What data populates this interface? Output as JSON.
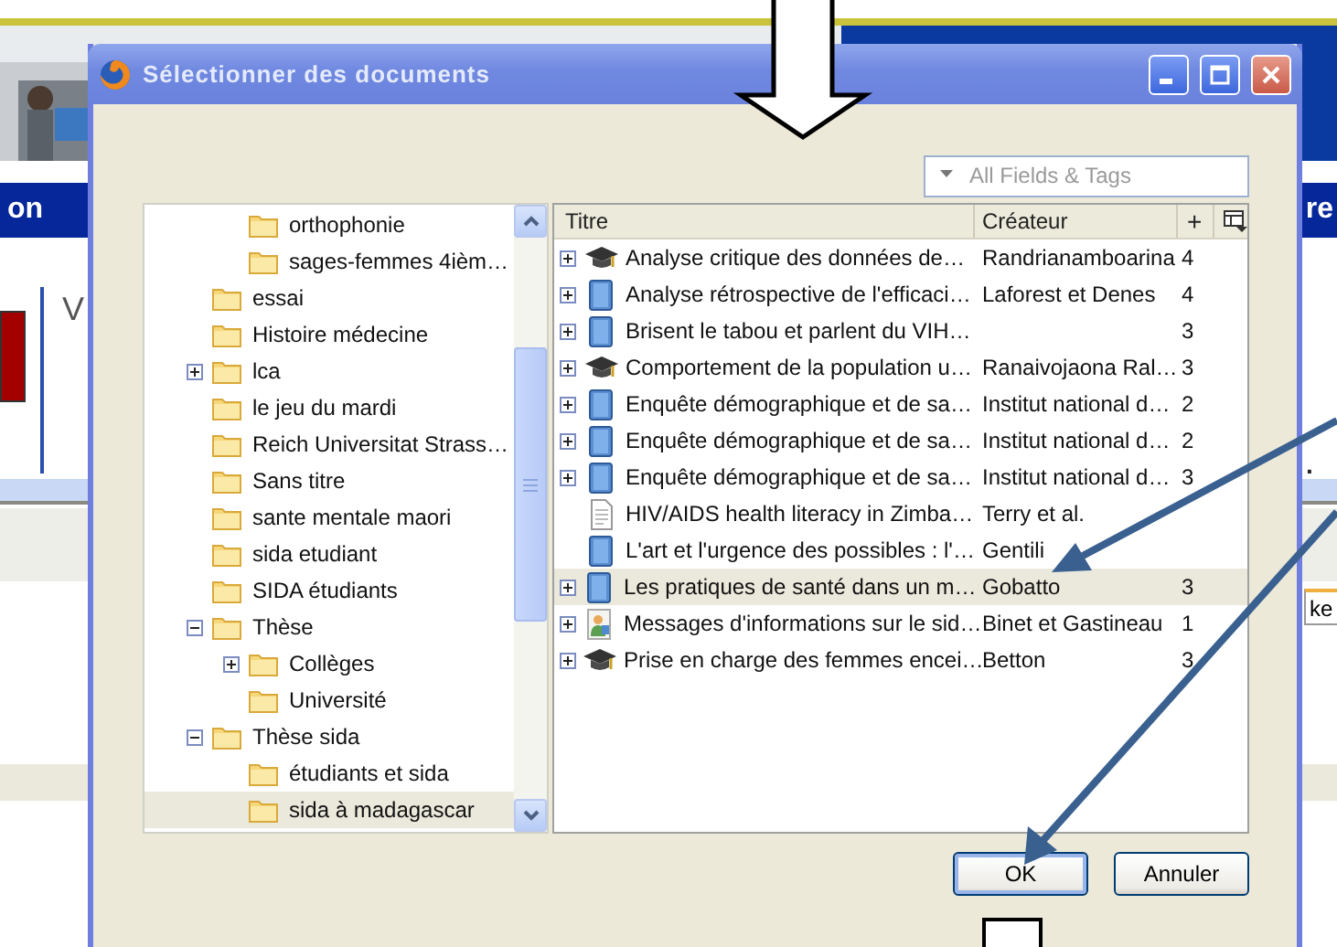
{
  "background_page": {
    "nav_left": "on",
    "nav_right": "re",
    "heading_letter": "V",
    "period": ".",
    "field_value": "ke"
  },
  "dialog": {
    "title": "Sélectionner des documents",
    "search": {
      "placeholder": "All Fields & Tags"
    },
    "tree": [
      {
        "children": [
          {
            "label": "orthophonie",
            "selected": false
          },
          {
            "label": "sages-femmes 4ièm…",
            "selected": false
          }
        ]
      },
      {
        "label": "essai",
        "selected": false
      },
      {
        "label": "Histoire médecine",
        "selected": false
      },
      {
        "label": "lca",
        "selected": false,
        "expanded": false
      },
      {
        "label": "le jeu du mardi",
        "selected": false
      },
      {
        "label": "Reich Universitat Strass…",
        "selected": false
      },
      {
        "label": "Sans titre",
        "selected": false
      },
      {
        "label": "sante mentale maori",
        "selected": false
      },
      {
        "label": "sida etudiant",
        "selected": false
      },
      {
        "label": "SIDA étudiants",
        "selected": false
      },
      {
        "label": "Thèse",
        "selected": false,
        "expanded": true,
        "children": [
          {
            "label": "Collèges",
            "selected": false,
            "expanded": false
          },
          {
            "label": "Université",
            "selected": false
          }
        ]
      },
      {
        "label": "Thèse sida",
        "selected": false,
        "expanded": true,
        "children": [
          {
            "label": "étudiants et sida",
            "selected": false
          },
          {
            "label": "sida à madagascar",
            "selected": true
          }
        ]
      }
    ],
    "list": {
      "columns": [
        "Titre",
        "Créateur",
        "+"
      ],
      "rows": [
        {
          "kind": "thesis",
          "expandable": true,
          "selected": false,
          "title": "Analyse critique  des données de…",
          "creator": "Randrianamboarina",
          "count": "4"
        },
        {
          "kind": "book",
          "expandable": true,
          "selected": false,
          "title": "Analyse rétrospective de l'efficaci…",
          "creator": "Laforest et Denes",
          "count": "4"
        },
        {
          "kind": "book",
          "expandable": true,
          "selected": false,
          "title": "Brisent le tabou et parlent du VIH…",
          "count": "3"
        },
        {
          "kind": "thesis",
          "expandable": true,
          "selected": false,
          "title": "Comportement de la population u…",
          "creator": "Ranaivojaona Ral…",
          "count": "3"
        },
        {
          "kind": "book",
          "expandable": true,
          "selected": false,
          "title": "Enquête démographique et de sa…",
          "creator": "Institut national d…",
          "count": "2"
        },
        {
          "kind": "book",
          "expandable": true,
          "selected": false,
          "title": "Enquête démographique et de sa…",
          "creator": "Institut national d…",
          "count": "2"
        },
        {
          "kind": "book",
          "expandable": true,
          "selected": false,
          "title": "Enquête démographique et de sa…",
          "creator": "Institut national d…",
          "count": "3"
        },
        {
          "kind": "document",
          "expandable": false,
          "selected": false,
          "title": "HIV/AIDS health literacy in Zimba…",
          "creator": "Terry et al."
        },
        {
          "kind": "book",
          "expandable": false,
          "selected": false,
          "title": "L'art et l'urgence des possibles : l'…",
          "creator": "Gentili"
        },
        {
          "kind": "book",
          "expandable": true,
          "selected": true,
          "title": "Les pratiques de santé dans un m…",
          "creator": "Gobatto",
          "count": "3"
        },
        {
          "kind": "multimedia",
          "expandable": true,
          "selected": false,
          "title": "Messages d'informations sur le sid…",
          "creator": "Binet et Gastineau",
          "count": "1"
        },
        {
          "kind": "thesis",
          "expandable": true,
          "selected": false,
          "title": "Prise en charge des femmes encei…",
          "creator": "Betton",
          "count": "3"
        }
      ]
    },
    "buttons": [
      {
        "label": "OK",
        "default": true
      },
      {
        "label": "Annuler",
        "default": false
      }
    ]
  }
}
